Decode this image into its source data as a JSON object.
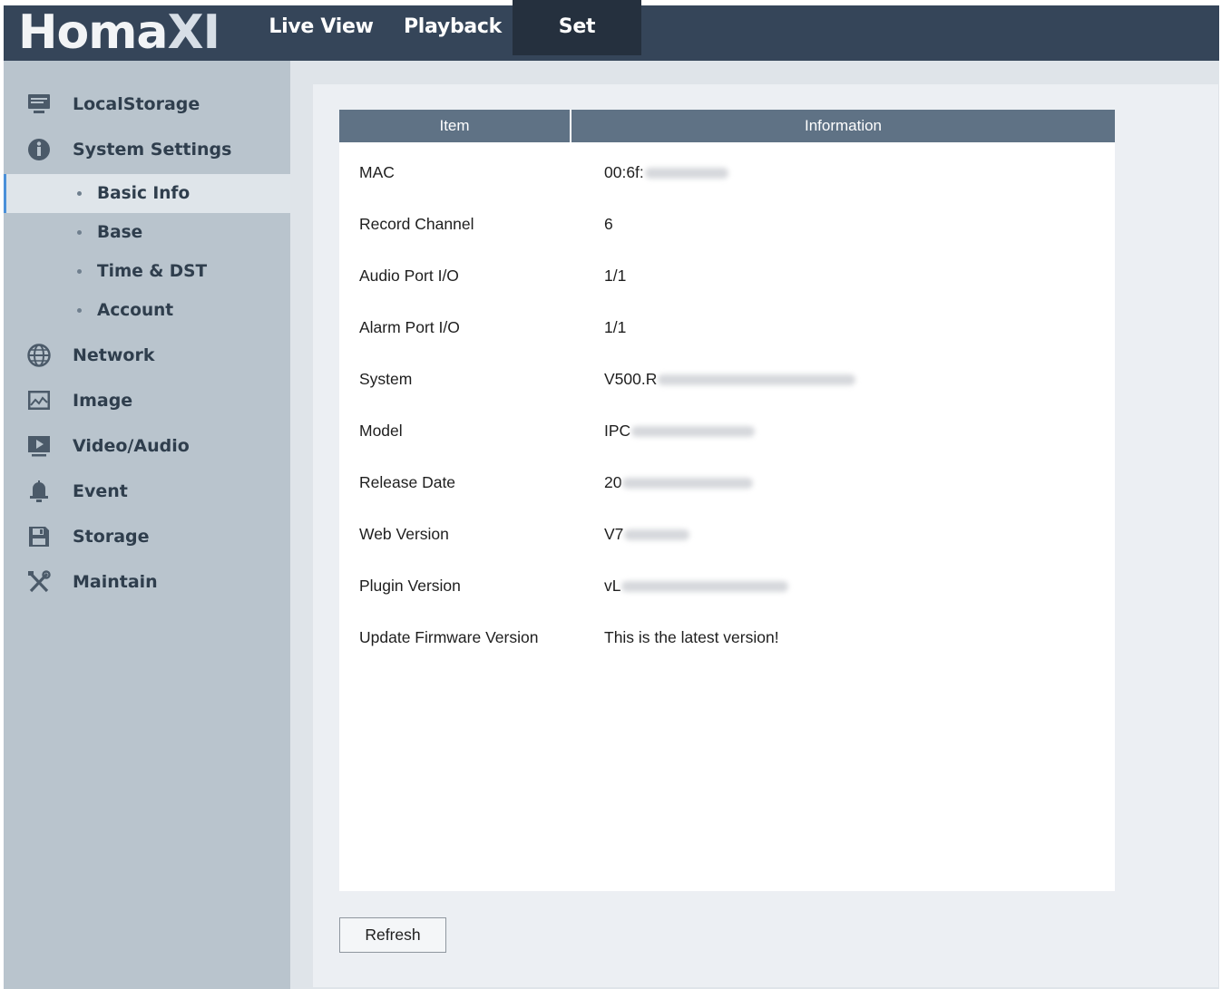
{
  "header": {
    "logo_main": "Homa",
    "logo_tail": "XI",
    "tabs": [
      {
        "label": "Live View",
        "active": false
      },
      {
        "label": "Playback",
        "active": false
      },
      {
        "label": "Set",
        "active": true
      }
    ]
  },
  "sidebar": {
    "items": [
      {
        "label": "LocalStorage",
        "icon": "monitor-icon"
      },
      {
        "label": "System Settings",
        "icon": "info-icon"
      },
      {
        "label": "Network",
        "icon": "globe-icon"
      },
      {
        "label": "Image",
        "icon": "image-icon"
      },
      {
        "label": "Video/Audio",
        "icon": "video-icon"
      },
      {
        "label": "Event",
        "icon": "bell-icon"
      },
      {
        "label": "Storage",
        "icon": "floppy-disk-icon"
      },
      {
        "label": "Maintain",
        "icon": "tools-icon"
      }
    ],
    "subitems": [
      {
        "label": "Basic Info",
        "active": true
      },
      {
        "label": "Base",
        "active": false
      },
      {
        "label": "Time & DST",
        "active": false
      },
      {
        "label": "Account",
        "active": false
      }
    ]
  },
  "table": {
    "headers": {
      "item": "Item",
      "info": "Information"
    },
    "rows": [
      {
        "item": "MAC",
        "info": "00:6f:",
        "blurred": true
      },
      {
        "item": "Record Channel",
        "info": "6",
        "blurred": false
      },
      {
        "item": "Audio Port I/O",
        "info": "1/1",
        "blurred": false
      },
      {
        "item": "Alarm Port I/O",
        "info": "1/1",
        "blurred": false
      },
      {
        "item": "System",
        "info": "V500.R",
        "blurred": true
      },
      {
        "item": "Model",
        "info": "IPC",
        "blurred": true
      },
      {
        "item": "Release Date",
        "info": "20",
        "blurred": true
      },
      {
        "item": "Web Version",
        "info": "V7",
        "blurred": true
      },
      {
        "item": "Plugin Version",
        "info": "vL",
        "blurred": true
      },
      {
        "item": "Update Firmware Version",
        "info": "This is the latest version!",
        "blurred": false
      }
    ]
  },
  "actions": {
    "refresh_label": "Refresh"
  },
  "colors": {
    "topbar": "#354559",
    "active_tab": "#25303e",
    "sidebar": "#b9c4cd",
    "table_header": "#5f7285",
    "active_indicator": "#4a90d9"
  }
}
